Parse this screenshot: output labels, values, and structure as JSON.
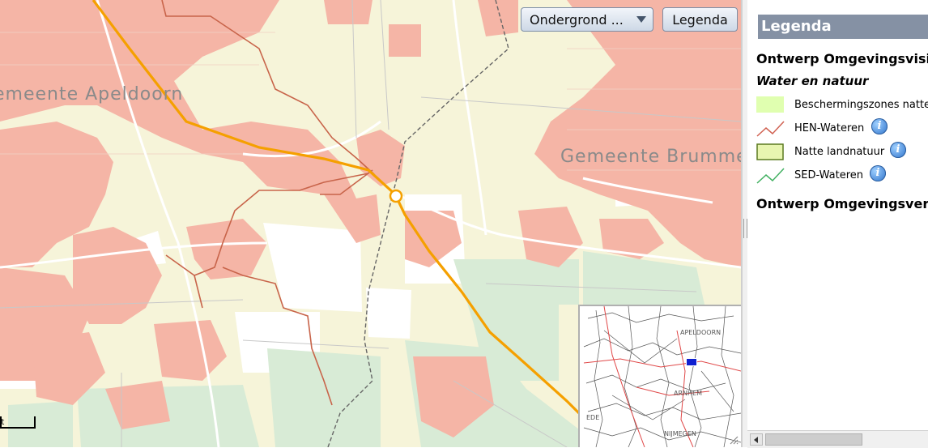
{
  "map": {
    "labels": {
      "apeldoorn": "emeente Apeldoorn",
      "brummen": "Gemeente Brummen"
    },
    "basemap_select": {
      "value": "Ondergrond ..."
    },
    "legend_button": "Legenda",
    "scale_text": "ft",
    "overview": {
      "labels": {
        "apeldoorn": "APELDOORN",
        "arnhem": "ARNHEM",
        "nijmegen": "NIJMEGEN",
        "ede": "EDE"
      }
    },
    "colors": {
      "background": "#f6f4d9",
      "built_up": "#f5b5a6",
      "green": "#d7ebd7",
      "road": "#f5a000",
      "hen_water": "#c8644a",
      "boundary": "#666666"
    }
  },
  "legend": {
    "header": "Legenda",
    "title1": "Ontwerp Omgevingsvisie",
    "group": "Water en natuur",
    "items": [
      {
        "label": "Beschermingszones natte natuur",
        "symbol": "fill-light-green",
        "color": "#e0ffb0",
        "info": false
      },
      {
        "label": "HEN-Wateren",
        "symbol": "line-red",
        "color": "#d06050",
        "info": true
      },
      {
        "label": "Natte landnatuur",
        "symbol": "fill-green-outline",
        "color": "#e8f5b0",
        "info": true
      },
      {
        "label": "SED-Wateren",
        "symbol": "line-green",
        "color": "#40b060",
        "info": true
      }
    ],
    "title2": "Ontwerp Omgevingsverordening",
    "info_icon_text": "i"
  }
}
